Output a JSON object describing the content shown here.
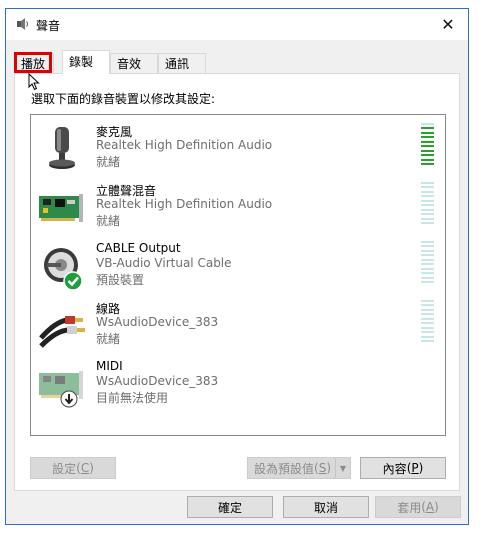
{
  "window": {
    "title": "聲音",
    "close_glyph": "✕"
  },
  "tabs": [
    {
      "label": "播放",
      "active": false
    },
    {
      "label": "錄製",
      "active": true
    },
    {
      "label": "音效",
      "active": false
    },
    {
      "label": "通訊",
      "active": false
    }
  ],
  "instruction": "選取下面的錄音裝置以修改其設定:",
  "devices": [
    {
      "name": "麥克風",
      "driver": "Realtek High Definition Audio",
      "status": "就緒",
      "icon": "microphone-icon",
      "level_bars_on": 9
    },
    {
      "name": "立體聲混音",
      "driver": "Realtek High Definition Audio",
      "status": "就緒",
      "icon": "sound-card-icon",
      "level_bars_on": 0
    },
    {
      "name": "CABLE Output",
      "driver": "VB-Audio Virtual Cable",
      "status": "預設裝置",
      "icon": "cable-default-icon",
      "level_bars_on": 0
    },
    {
      "name": "線路",
      "driver": "WsAudioDevice_383",
      "status": "就緒",
      "icon": "rca-cable-icon",
      "level_bars_on": 0
    },
    {
      "name": "MIDI",
      "driver": "WsAudioDevice_383",
      "status": "目前無法使用",
      "icon": "midi-card-icon",
      "level_bars_on": null
    }
  ],
  "buttons": {
    "configure": {
      "label": "設定",
      "mnemonic": "C",
      "enabled": false
    },
    "set_default": {
      "label": "設為預設值",
      "mnemonic": "S",
      "enabled": false
    },
    "properties": {
      "label": "內容",
      "mnemonic": "P",
      "enabled": true
    },
    "ok": {
      "label": "確定",
      "enabled": true
    },
    "cancel": {
      "label": "取消",
      "enabled": true
    },
    "apply": {
      "label": "套用",
      "mnemonic": "A",
      "enabled": false
    }
  },
  "colors": {
    "meter_active": "#2aa02a",
    "meter_idle": "#c8e6e6",
    "highlight": "#e00000",
    "window_border": "#2b6fcd"
  }
}
